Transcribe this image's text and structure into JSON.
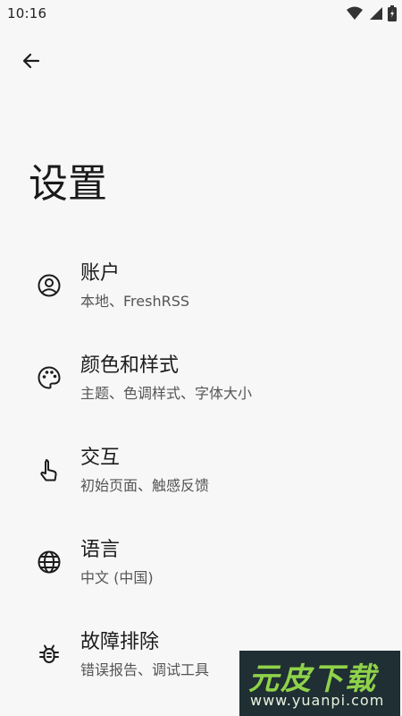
{
  "status_bar": {
    "time": "10:16",
    "icons": [
      "wifi-icon",
      "signal-icon",
      "battery-icon"
    ]
  },
  "header": {
    "back_icon": "arrow-left-icon",
    "title": "设置"
  },
  "settings": [
    {
      "icon": "account-circle-icon",
      "title": "账户",
      "subtitle": "本地、FreshRSS"
    },
    {
      "icon": "palette-icon",
      "title": "颜色和样式",
      "subtitle": "主题、色调样式、字体大小"
    },
    {
      "icon": "touch-icon",
      "title": "交互",
      "subtitle": "初始页面、触感反馈"
    },
    {
      "icon": "globe-icon",
      "title": "语言",
      "subtitle": "中文 (中国)"
    },
    {
      "icon": "bug-icon",
      "title": "故障排除",
      "subtitle": "错误报告、调试工具"
    }
  ],
  "watermark": {
    "text": "元皮下载",
    "url": "www.yuanpi.com"
  }
}
